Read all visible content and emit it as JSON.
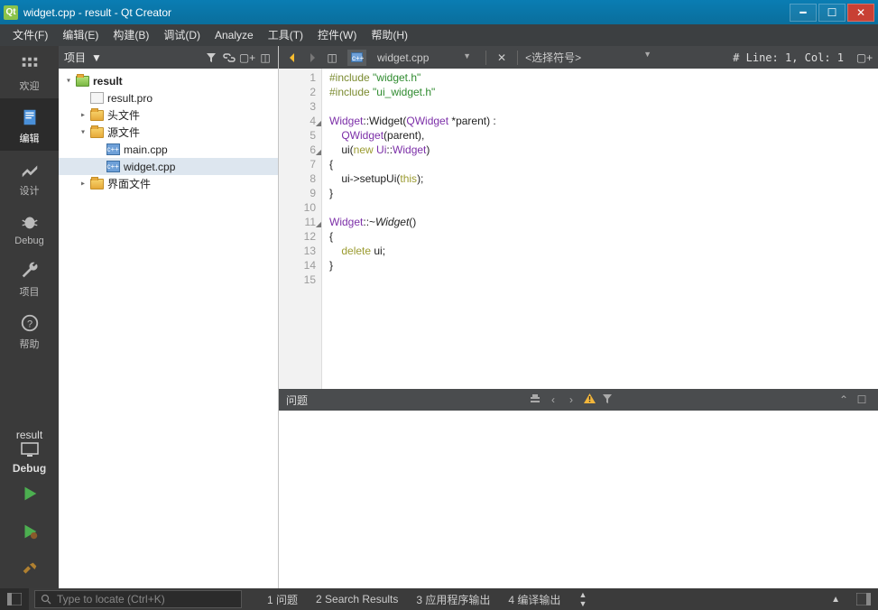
{
  "window": {
    "title": "widget.cpp - result - Qt Creator"
  },
  "menu": [
    "文件(F)",
    "编辑(E)",
    "构建(B)",
    "调试(D)",
    "Analyze",
    "工具(T)",
    "控件(W)",
    "帮助(H)"
  ],
  "modes": {
    "welcome": "欢迎",
    "edit": "编辑",
    "design": "设计",
    "debug": "Debug",
    "projects": "项目",
    "help": "帮助"
  },
  "target": {
    "project": "result",
    "config": "Debug"
  },
  "projectPane": {
    "title": "项目"
  },
  "tree": {
    "root": "result",
    "pro": "result.pro",
    "headersFolder": "头文件",
    "sourcesFolder": "源文件",
    "sources": [
      "main.cpp",
      "widget.cpp"
    ],
    "formsFolder": "界面文件"
  },
  "editor": {
    "filename": "widget.cpp",
    "symbolPlaceholder": "<选择符号>",
    "lineinfo": "# Line: 1, Col: 1"
  },
  "code": {
    "lines": [
      {
        "n": 1,
        "html": "<span class='k-pre'>#include</span> <span class='k-str'>\"widget.h\"</span>"
      },
      {
        "n": 2,
        "html": "<span class='k-pre'>#include</span> <span class='k-str'>\"ui_widget.h\"</span>"
      },
      {
        "n": 3,
        "html": ""
      },
      {
        "n": 4,
        "fold": true,
        "html": "<span class='k-type'>Widget</span>::Widget(<span class='k-type'>QWidget</span> *parent) :"
      },
      {
        "n": 5,
        "html": "    <span class='k-type'>QWidget</span>(parent),"
      },
      {
        "n": 6,
        "fold": true,
        "html": "    ui(<span class='k-key'>new</span> <span class='k-type'>Ui</span>::<span class='k-type'>Widget</span>)"
      },
      {
        "n": 7,
        "html": "{"
      },
      {
        "n": 8,
        "html": "    ui-&gt;setupUi(<span class='k-key'>this</span>);"
      },
      {
        "n": 9,
        "html": "}"
      },
      {
        "n": 10,
        "html": ""
      },
      {
        "n": 11,
        "fold": true,
        "html": "<span class='k-type'>Widget</span>::~<i>Widget</i>()"
      },
      {
        "n": 12,
        "html": "{"
      },
      {
        "n": 13,
        "html": "    <span class='k-key'>delete</span> ui;"
      },
      {
        "n": 14,
        "html": "}"
      },
      {
        "n": 15,
        "html": ""
      }
    ]
  },
  "issuesPane": {
    "title": "问题"
  },
  "locator": {
    "placeholder": "Type to locate (Ctrl+K)"
  },
  "bottomTabs": [
    "1 问题",
    "2 Search Results",
    "3 应用程序输出",
    "4 编译输出"
  ]
}
